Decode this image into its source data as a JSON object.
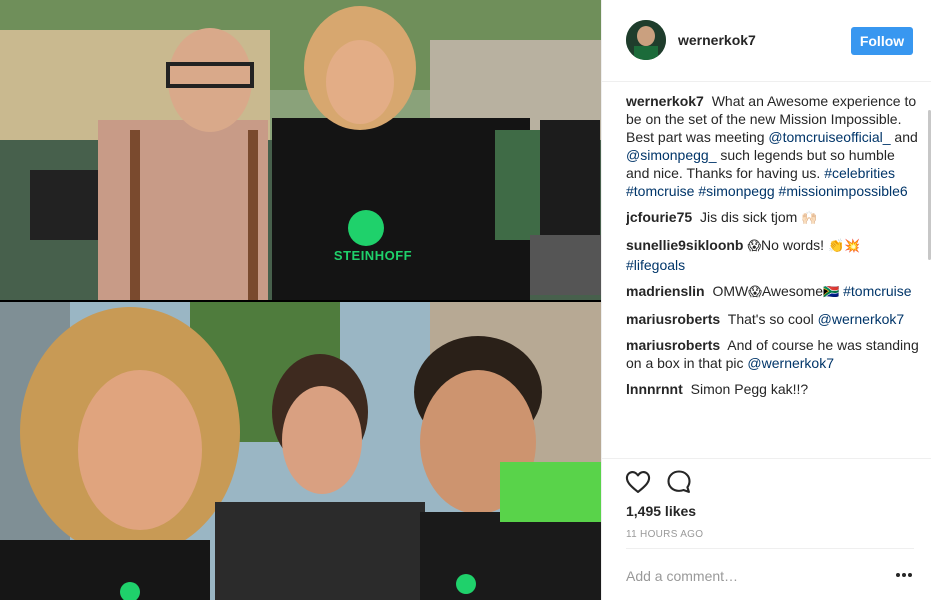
{
  "post": {
    "photos": [
      {
        "name": "set-photo",
        "description_icon": "photo"
      },
      {
        "name": "selfie-photo",
        "description_icon": "photo"
      }
    ],
    "jersey_logo_text": "STEINHOFF"
  },
  "header": {
    "username": "wernerkok7",
    "follow_label": "Follow"
  },
  "caption": {
    "username": "wernerkok7",
    "text_1": "What an Awesome experience to be on the set of the new Mission Impossible. Best part was meeting",
    "mention_1": "@tomcruiseofficial_",
    "text_2": "and",
    "mention_2": "@simonpegg_",
    "text_3": "such legends but so humble and nice. Thanks for having us.",
    "hashtags": [
      "#celebrities",
      "#tomcruise",
      "#simonpegg",
      "#missionimpossible6"
    ]
  },
  "comments": [
    {
      "username": "jcfourie75",
      "text": "Jis dis sick tjom",
      "emoji": "🙌🏻"
    },
    {
      "username": "sunellie9sikloonb",
      "emoji_before": "😱",
      "text": "No words!",
      "emoji": "👏💥",
      "tag": "#lifegoals"
    },
    {
      "username": "madrienslin",
      "text": "OMW",
      "emoji_mid": "😱",
      "text_2": "Awesome",
      "emoji": "🇿🇦",
      "tag": "#tomcruise"
    },
    {
      "username": "mariusroberts",
      "text": "That's so cool",
      "mention": "@wernerkok7"
    },
    {
      "username": "mariusroberts",
      "text": "And of course he was standing on a box in that pic",
      "mention": "@wernerkok7"
    },
    {
      "username": "lnnnrnnt",
      "text": "Simon Pegg kak!!?"
    }
  ],
  "actions": {
    "like_icon": "heart-outline-icon",
    "comment_icon": "speech-bubble-icon",
    "likes": "1,495 likes",
    "timestamp": "11 HOURS AGO"
  },
  "comment_form": {
    "placeholder": "Add a comment…",
    "more_icon": "ellipsis-icon"
  },
  "colors": {
    "follow_bg": "#3897f0",
    "link": "#003569",
    "muted": "#999999",
    "jersey_green": "#1fd16b"
  }
}
